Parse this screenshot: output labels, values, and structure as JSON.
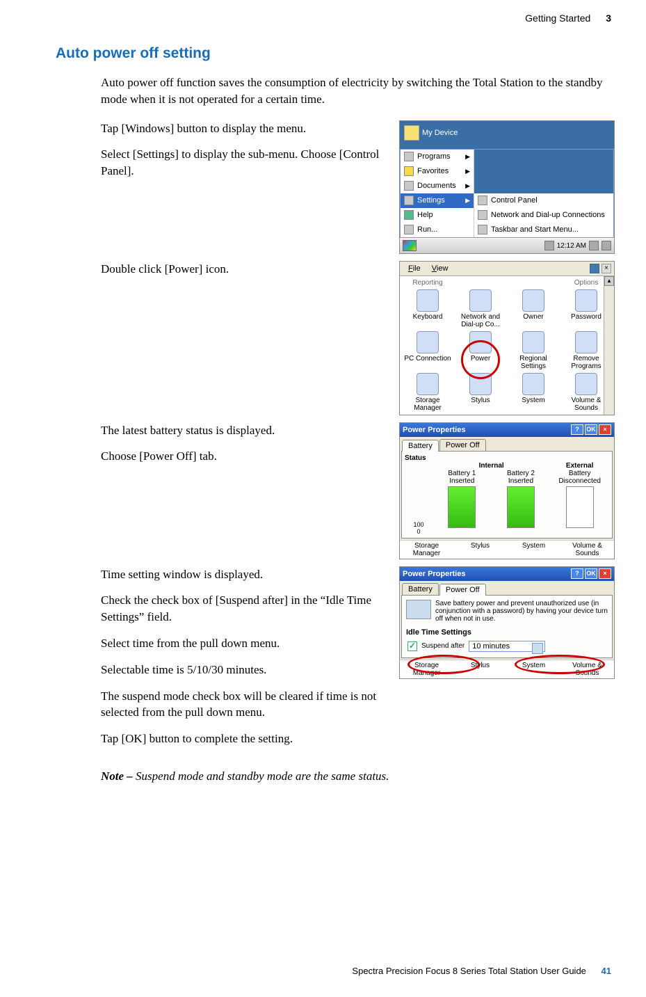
{
  "header": {
    "chapter_title": "Getting Started",
    "chapter_num": "3"
  },
  "title": "Auto power off setting",
  "intro": "Auto power off function saves the consumption of electricity by switching the Total Station to the standby mode when it is not operated for a certain time.",
  "step1": {
    "p1": "Tap [Windows] button to display the menu.",
    "p2": "Select [Settings] to display the sub-menu. Choose [Control Panel]."
  },
  "step2": {
    "p1": "Double click [Power] icon."
  },
  "step3": {
    "p1": "The latest battery status is displayed.",
    "p2": "Choose [Power Off] tab."
  },
  "step4": {
    "p1": "Time setting window is displayed.",
    "p2": "Check the check box of [Suspend after] in the “Idle Time Settings” field.",
    "p3": "Select time from the pull down menu.",
    "p4": "Selectable time is 5/10/30 minutes.",
    "p5": "The suspend mode check box will be cleared if time is not selected from the pull down menu.",
    "p6": "Tap [OK] button to complete the setting."
  },
  "note": {
    "label": "Note – ",
    "text": "Suspend mode and standby mode are the same status."
  },
  "footer": {
    "guide": "Spectra Precision Focus 8 Series Total Station User Guide",
    "page": "41"
  },
  "fig1": {
    "desktop_label": "My Device",
    "left_items": [
      "Programs",
      "Favorites",
      "Documents",
      "Settings",
      "Help",
      "Run..."
    ],
    "right_items": [
      "Control Panel",
      "Network and Dial-up Connections",
      "Taskbar and Start Menu..."
    ],
    "selected_left": "Settings",
    "clock": "12:12 AM"
  },
  "fig2": {
    "menu_file": "File",
    "menu_view": "View",
    "top_cut": [
      "Reporting",
      "",
      "",
      "Options"
    ],
    "items_row1": [
      "Keyboard",
      "Network and Dial-up Co...",
      "Owner",
      "Password"
    ],
    "items_row2": [
      "PC Connection",
      "Power",
      "Regional Settings",
      "Remove Programs"
    ],
    "items_row3": [
      "Storage Manager",
      "Stylus",
      "System",
      "Volume & Sounds"
    ],
    "highlight": "Power"
  },
  "fig3": {
    "title": "Power Properties",
    "tab_battery": "Battery",
    "tab_poweroff": "Power Off",
    "status": "Status",
    "col_internal": "Internal",
    "col_external": "External",
    "b1_label": "Battery 1",
    "b1_state": "Inserted",
    "b2_label": "Battery 2",
    "b2_state": "Inserted",
    "ext_label": "Battery",
    "ext_state": "Disconnected",
    "y_hi": "100",
    "y_lo": "0",
    "bottom": [
      "Storage Manager",
      "Stylus",
      "System",
      "Volume & Sounds"
    ]
  },
  "fig4": {
    "title": "Power Properties",
    "tab_battery": "Battery",
    "tab_poweroff": "Power Off",
    "desc": "Save battery power and prevent unauthorized use (in conjunction with a password) by having your device turn off when not in use.",
    "group": "Idle Time Settings",
    "chk_label": "Suspend after",
    "select_value": "10 minutes",
    "bottom": [
      "Storage Manager",
      "Stylus",
      "System",
      "Volume & Sounds"
    ]
  }
}
